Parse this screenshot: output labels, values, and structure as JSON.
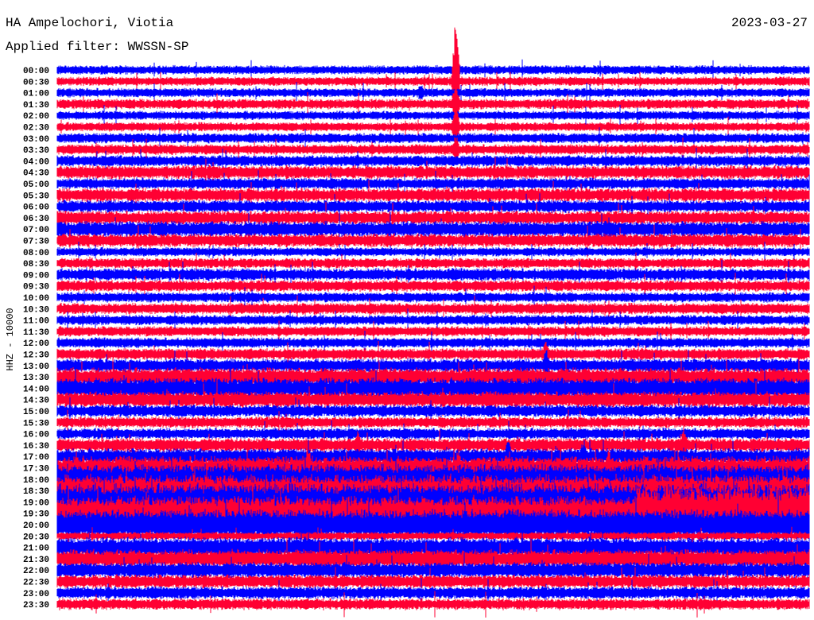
{
  "header": {
    "station": "HA Ampelochori, Viotia",
    "filter": "Applied filter: WWSSN-SP",
    "date": "2023-03-27",
    "channel_label": "HHZ - 10000"
  },
  "colors": {
    "even_trace": "#0000ff",
    "odd_trace": "#ff0033"
  },
  "chart_data": {
    "type": "line",
    "title": "HA Ampelochori, Viotia",
    "ylabel": "HHZ - 10000",
    "minutes_per_line": 30,
    "amplitude_unit": "trace spacing",
    "rows": [
      {
        "label": "00:00",
        "amp": 0.4
      },
      {
        "label": "00:30",
        "amp": 0.4,
        "spikes": [
          [
            15.9,
            7.0
          ]
        ]
      },
      {
        "label": "01:00",
        "amp": 0.4,
        "spikes": [
          [
            14.5,
            1.0
          ]
        ]
      },
      {
        "label": "01:30",
        "amp": 0.45,
        "spikes": [
          [
            15.9,
            2.5
          ]
        ]
      },
      {
        "label": "02:00",
        "amp": 0.4
      },
      {
        "label": "02:30",
        "amp": 0.4,
        "spikes": [
          [
            15.9,
            2.5
          ]
        ]
      },
      {
        "label": "03:00",
        "amp": 0.45
      },
      {
        "label": "03:30",
        "amp": 0.45,
        "spikes": [
          [
            15.9,
            1.5
          ]
        ]
      },
      {
        "label": "04:00",
        "amp": 0.5
      },
      {
        "label": "04:30",
        "amp": 0.6
      },
      {
        "label": "05:00",
        "amp": 0.5
      },
      {
        "label": "05:30",
        "amp": 0.6
      },
      {
        "label": "06:00",
        "amp": 0.55
      },
      {
        "label": "06:30",
        "amp": 0.6
      },
      {
        "label": "07:00",
        "amp": 0.7
      },
      {
        "label": "07:30",
        "amp": 0.6
      },
      {
        "label": "08:00",
        "amp": 0.4
      },
      {
        "label": "08:30",
        "amp": 0.45
      },
      {
        "label": "09:00",
        "amp": 0.55
      },
      {
        "label": "09:30",
        "amp": 0.5
      },
      {
        "label": "10:00",
        "amp": 0.45
      },
      {
        "label": "10:30",
        "amp": 0.5
      },
      {
        "label": "11:00",
        "amp": 0.45
      },
      {
        "label": "11:30",
        "amp": 0.45
      },
      {
        "label": "12:00",
        "amp": 0.45
      },
      {
        "label": "12:30",
        "amp": 0.5,
        "spikes": [
          [
            19.5,
            1.5
          ]
        ]
      },
      {
        "label": "13:00",
        "amp": 0.6,
        "spikes": [
          [
            19.5,
            2.0
          ]
        ]
      },
      {
        "label": "13:30",
        "amp": 0.8
      },
      {
        "label": "14:00",
        "amp": 0.9
      },
      {
        "label": "14:30",
        "amp": 0.7
      },
      {
        "label": "15:00",
        "amp": 0.55
      },
      {
        "label": "15:30",
        "amp": 0.5
      },
      {
        "label": "16:00",
        "amp": 0.5
      },
      {
        "label": "16:30",
        "amp": 0.6,
        "spikes": [
          [
            25.0,
            2.0
          ],
          [
            12.0,
            1.5
          ]
        ]
      },
      {
        "label": "17:00",
        "amp": 0.7,
        "spikes": [
          [
            18.0,
            2.0
          ],
          [
            21.0,
            1.8
          ]
        ]
      },
      {
        "label": "17:30",
        "amp": 1.0,
        "spikes": [
          [
            10.0,
            2.5
          ],
          [
            16.0,
            2.2
          ],
          [
            22.0,
            2.0
          ]
        ]
      },
      {
        "label": "18:00",
        "amp": 1.3
      },
      {
        "label": "18:30",
        "amp": 1.4
      },
      {
        "label": "19:00",
        "amp": 1.6
      },
      {
        "label": "19:30",
        "amp": 1.5,
        "late_amp": 2.4
      },
      {
        "label": "20:00",
        "amp": 1.3
      },
      {
        "label": "20:30",
        "amp": 0.35
      },
      {
        "label": "21:00",
        "amp": 0.9
      },
      {
        "label": "21:30",
        "amp": 0.8
      },
      {
        "label": "22:00",
        "amp": 0.7
      },
      {
        "label": "22:30",
        "amp": 0.6
      },
      {
        "label": "23:00",
        "amp": 0.55
      },
      {
        "label": "23:30",
        "amp": 0.5
      }
    ]
  }
}
